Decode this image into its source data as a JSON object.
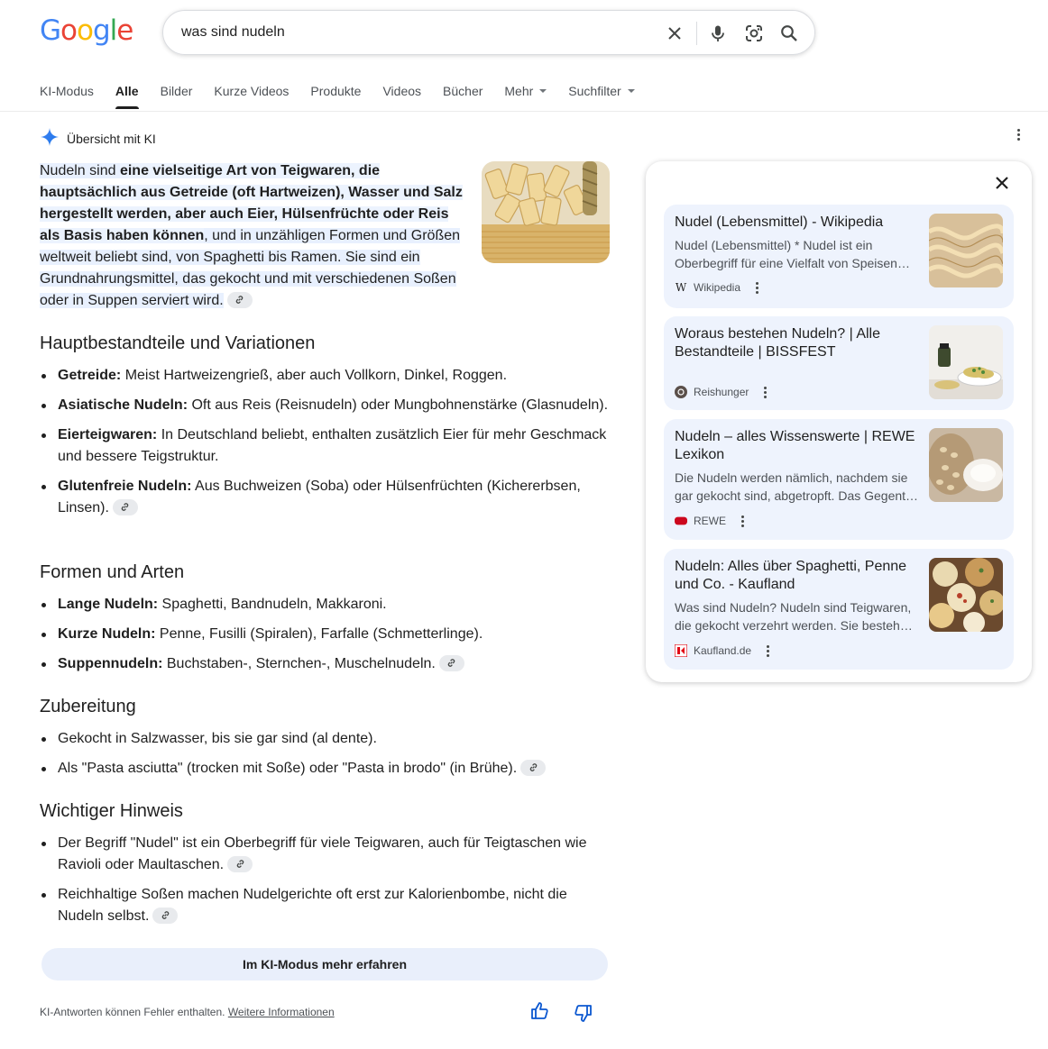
{
  "logo": "Google",
  "search": {
    "query": "was sind nudeln"
  },
  "tabs": [
    "KI-Modus",
    "Alle",
    "Bilder",
    "Kurze Videos",
    "Produkte",
    "Videos",
    "Bücher",
    "Mehr",
    "Suchfilter"
  ],
  "active_tab": "Alle",
  "overview": {
    "title": "Übersicht mit KI",
    "intro": {
      "p1": "Nudeln sind ",
      "p2": "eine vielseitige Art von Teigwaren, die hauptsächlich aus Getreide (oft Hartweizen), Wasser und Salz hergestellt werden, aber auch Eier, Hülsenfrüchte oder Reis als Basis haben können",
      "p3": ", und in unzähligen Formen und Größen weltweit beliebt sind, von Spaghetti bis Ramen. Sie sind ein Grundnahrungsmittel, das gekocht und mit verschiedenen Soßen oder in Suppen serviert wird."
    },
    "sections": [
      {
        "heading": "Hauptbestandteile und Variationen",
        "items": [
          {
            "bold": "Getreide:",
            "text": " Meist Hartweizengrieß, aber auch Vollkorn, Dinkel, Roggen."
          },
          {
            "bold": "Asiatische Nudeln:",
            "text": " Oft aus Reis (Reisnudeln) oder Mungbohnenstärke (Glasnudeln)."
          },
          {
            "bold": "Eierteigwaren:",
            "text": " In Deutschland beliebt, enthalten zusätzlich Eier für mehr Geschmack und bessere Teigstruktur."
          },
          {
            "bold": "Glutenfreie Nudeln:",
            "text": " Aus Buchweizen (Soba) oder Hülsenfrüchten (Kichererbsen, Linsen)."
          }
        ]
      },
      {
        "heading": "Formen und Arten",
        "items": [
          {
            "bold": "Lange Nudeln:",
            "text": " Spaghetti, Bandnudeln, Makkaroni."
          },
          {
            "bold": "Kurze Nudeln:",
            "text": " Penne, Fusilli (Spiralen), Farfalle (Schmetterlinge)."
          },
          {
            "bold": "Suppennudeln:",
            "text": " Buchstaben-, Sternchen-, Muschelnudeln."
          }
        ]
      },
      {
        "heading": "Zubereitung",
        "items": [
          {
            "text": "Gekocht in Salzwasser, bis sie gar sind (al dente)."
          },
          {
            "text": "Als \"Pasta asciutta\" (trocken mit Soße) oder \"Pasta in brodo\" (in Brühe)."
          }
        ]
      },
      {
        "heading": "Wichtiger Hinweis",
        "items": [
          {
            "text": "Der Begriff \"Nudel\" ist ein Oberbegriff für viele Teigwaren, auch für Teigtaschen wie Ravioli oder Maultaschen."
          },
          {
            "text": "Reichhaltige Soßen machen Nudelgerichte oft erst zur Kalorienbombe, nicht die Nudeln selbst."
          }
        ]
      }
    ],
    "mode_button": "Im KI-Modus mehr erfahren",
    "disclaimer": "KI-Antworten können Fehler enthalten.",
    "disclaimer_link": "Weitere Informationen"
  },
  "sources": [
    {
      "title": "Nudel (Lebensmittel) - Wikipedia",
      "snippet": "Nudel (Lebensmittel) * Nudel ist ein Oberbegriff für eine Vielfalt von Speisen…",
      "site": "Wikipedia"
    },
    {
      "title": "Woraus bestehen Nudeln? | Alle Bestandteile | BISSFEST",
      "snippet": "",
      "site": "Reishunger"
    },
    {
      "title": "Nudeln – alles Wissenswerte | REWE Lexikon",
      "snippet": "Die Nudeln werden nämlich, nachdem sie gar gekocht sind, abgetropft. Das Gegent…",
      "site": "REWE"
    },
    {
      "title": "Nudeln: Alles über Spaghetti, Penne und Co. - Kaufland",
      "snippet": "Was sind Nudeln? Nudeln sind Teigwaren, die gekocht verzehrt werden. Sie besteh…",
      "site": "Kaufland.de"
    }
  ],
  "colors": {
    "accent_blue": "#0b57d0",
    "highlight": "#d3e3fd",
    "card_bg": "#eef3fd"
  }
}
